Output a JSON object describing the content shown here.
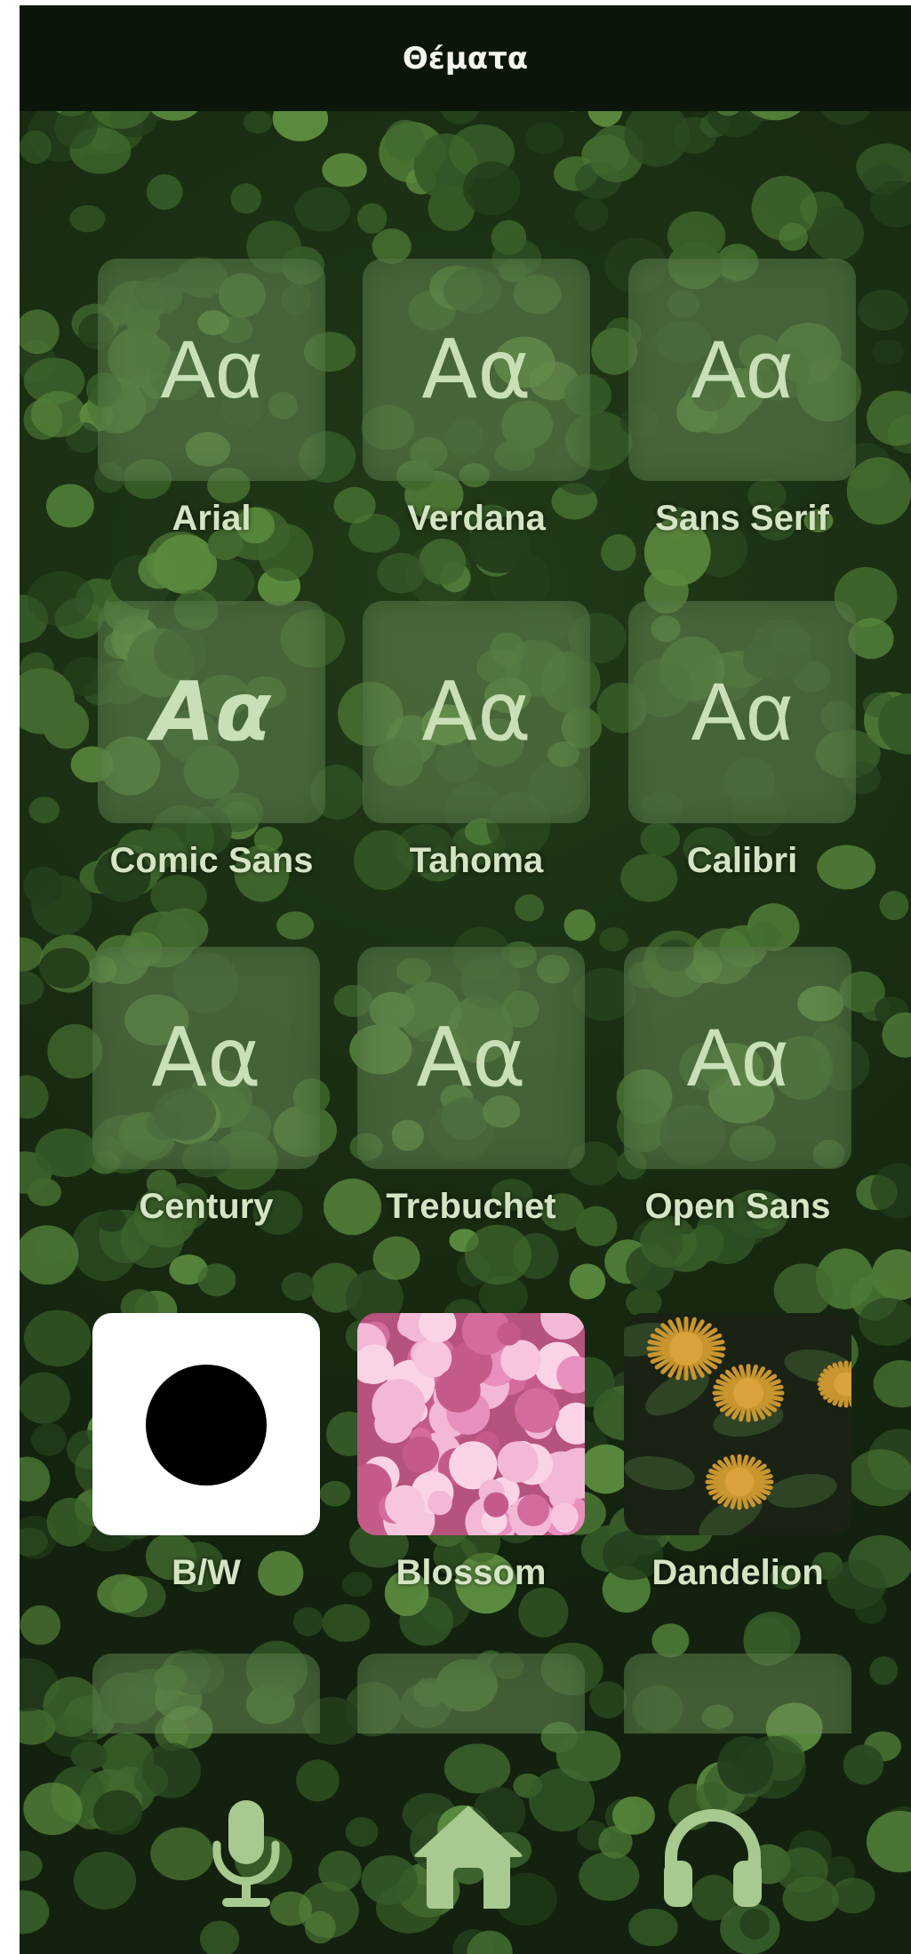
{
  "header": {
    "title": "Θέματα"
  },
  "fonts": {
    "sample": "Aα",
    "items": [
      {
        "label": "Arial"
      },
      {
        "label": "Verdana"
      },
      {
        "label": "Sans Serif"
      },
      {
        "label": "Comic Sans"
      },
      {
        "label": "Tahoma"
      },
      {
        "label": "Calibri"
      },
      {
        "label": "Century"
      },
      {
        "label": "Trebuchet"
      },
      {
        "label": "Open Sans"
      }
    ]
  },
  "themes": {
    "items": [
      {
        "label": "B/W",
        "icon": "bw-theme-icon"
      },
      {
        "label": "Blossom",
        "icon": "blossom-theme-icon"
      },
      {
        "label": "Dandelion",
        "icon": "dandelion-theme-icon"
      }
    ]
  },
  "nav": {
    "items": [
      {
        "name": "microphone-icon"
      },
      {
        "name": "home-icon"
      },
      {
        "name": "headphones-icon"
      }
    ]
  },
  "colors": {
    "accent": "#a8c98f",
    "header_bg": "#0b150a",
    "label": "#d3e5c4"
  }
}
